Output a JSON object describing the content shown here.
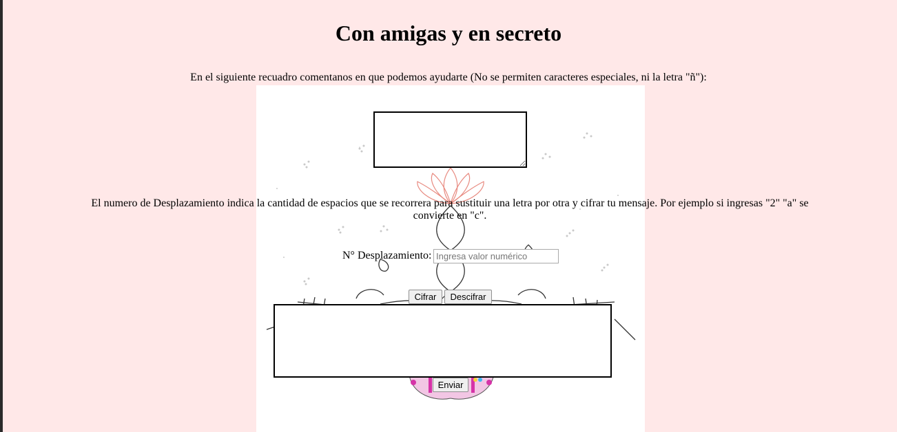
{
  "page": {
    "title": "Con amigas y en secreto",
    "intro_text": "En el siguiente recuadro comentanos en que podemos ayudarte (No se permiten caracteres especiales, ni la letra \"ñ\"):",
    "explanation_text": "El numero de Desplazamiento indica la cantidad de espacios que se recorrera para sustituir una letra por otra y cifrar tu mensaje. Por ejemplo si ingresas \"2\" \"a\" se convierte en \"c\"."
  },
  "message_input": {
    "value": ""
  },
  "shift": {
    "label": "N° Desplazamiento:",
    "placeholder": "Ingresa valor numérico",
    "value": ""
  },
  "buttons": {
    "encrypt_label": "Cifrar",
    "decrypt_label": "Descifrar",
    "send_label": "Enviar"
  },
  "result_output": {
    "value": ""
  },
  "colors": {
    "page_background": "#ffe8e8",
    "panel_background": "#ffffff",
    "lotus_accent": "#e88a80",
    "skirt_accent": "#d633a8"
  },
  "decoration": {
    "illustration_icon": "lotus-serpent-illustration-icon"
  }
}
